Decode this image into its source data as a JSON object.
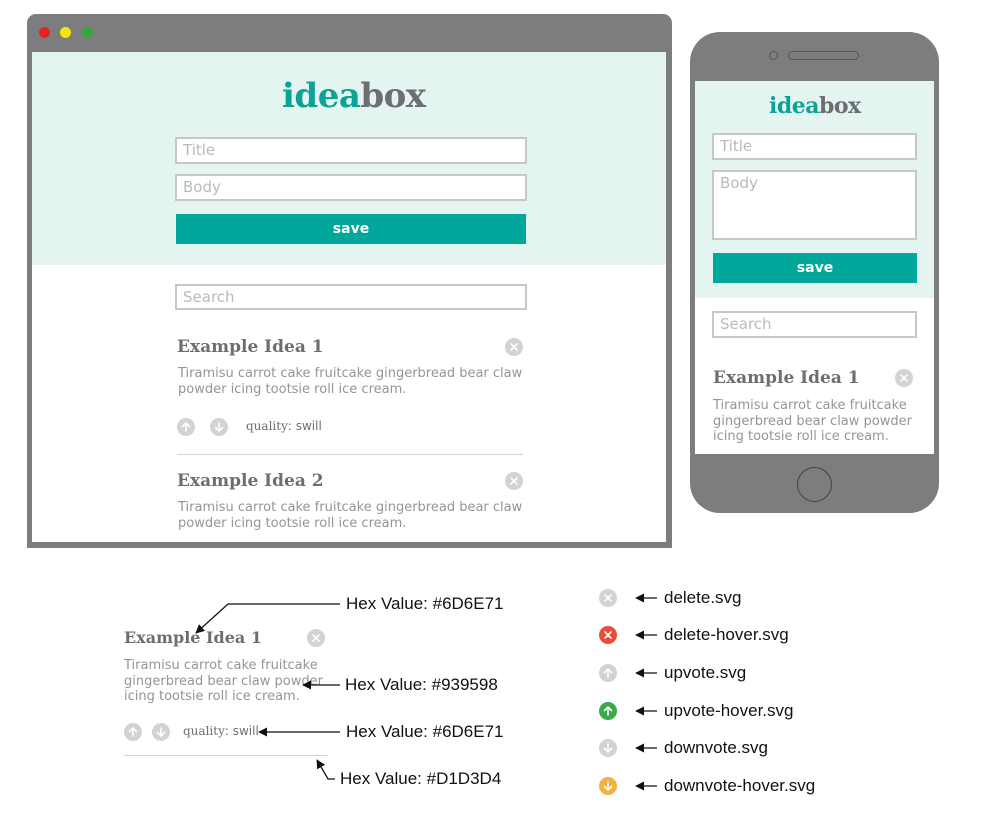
{
  "logo": {
    "part1": "idea",
    "part2": "box"
  },
  "form": {
    "title_placeholder": "Title",
    "body_placeholder": "Body",
    "save_label": "save"
  },
  "search": {
    "placeholder": "Search"
  },
  "ideas": [
    {
      "title": "Example Idea 1",
      "body": "Tiramisu carrot cake fruitcake gingerbread bear claw powder icing tootsie roll ice cream.",
      "quality_label": "quality",
      "quality_value": "swill"
    },
    {
      "title": "Example Idea 2",
      "body": "Tiramisu carrot cake fruitcake gingerbread bear claw powder icing tootsie roll ice cream."
    }
  ],
  "callouts": {
    "title_color": "Hex Value: #6D6E71",
    "body_color": "Hex Value: #939598",
    "quality_color": "Hex Value: #6D6E71",
    "divider_color": "Hex Value: #D1D3D4"
  },
  "icons": [
    {
      "name": "delete-icon",
      "file": "delete.svg"
    },
    {
      "name": "delete-hover-icon",
      "file": "delete-hover.svg"
    },
    {
      "name": "upvote-icon",
      "file": "upvote.svg"
    },
    {
      "name": "upvote-hover-icon",
      "file": "upvote-hover.svg"
    },
    {
      "name": "downvote-icon",
      "file": "downvote.svg"
    },
    {
      "name": "downvote-hover-icon",
      "file": "downvote-hover.svg"
    }
  ],
  "colors": {
    "brand_teal": "#00a79a",
    "header_bg": "#e4f4f0",
    "title_gray": "#6d6e71",
    "body_gray": "#939598",
    "divider_gray": "#d1d3d4",
    "icon_gray": "#d1d3d4",
    "delete_hover_red": "#e84c3d",
    "upvote_hover_green": "#3aaa49",
    "downvote_hover_orange": "#f3b23f",
    "window_red": "#e6231f",
    "window_yellow": "#f6e50b",
    "window_green": "#3aa53d"
  }
}
